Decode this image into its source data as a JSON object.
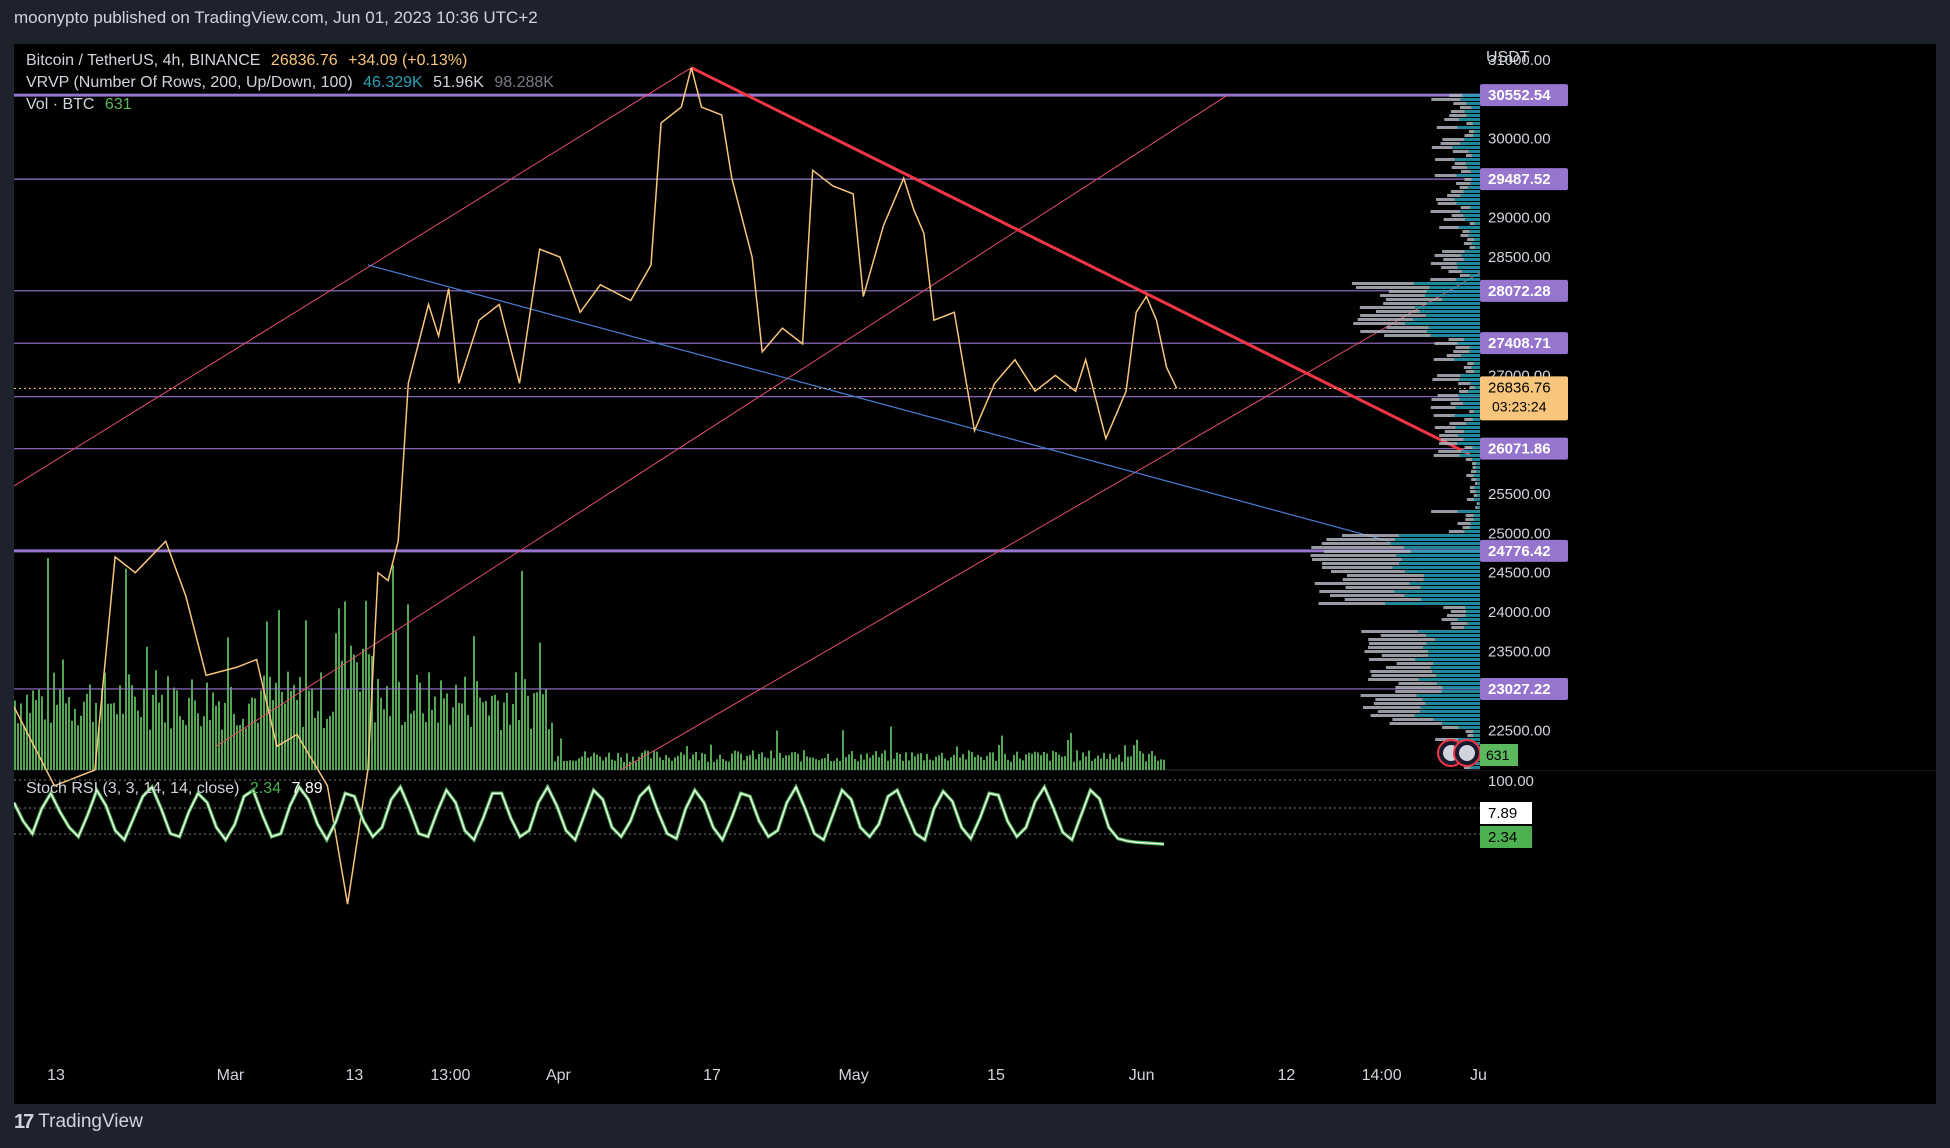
{
  "publisher_line": "moonypto published on TradingView.com, Jun 01, 2023 10:36 UTC+2",
  "footer_brand": "TradingView",
  "legend": {
    "symbol": "Bitcoin / TetherUS, 4h, BINANCE",
    "price": "26836.76",
    "change": "+34.09 (+0.13%)",
    "vrvp_label": "VRVP (Number Of Rows, 200, Up/Down, 100)",
    "vrvp_up": "46.329K",
    "vrvp_down": "51.96K",
    "vrvp_total": "98.288K",
    "vol_label": "Vol · BTC",
    "vol_value": "631",
    "stoch_label": "Stoch RSI (3, 3, 14, 14, close)",
    "stoch_k": "2.34",
    "stoch_d": "7.89"
  },
  "colors": {
    "background": "#000000",
    "price_line": "#f7c57b",
    "volume": "#5cb85c",
    "level_line": "#9575cd",
    "trendline_red": "#f23645",
    "channel_red": "#e04f6a",
    "blue_line": "#4a7fd6",
    "vrvp_up": "#26a0b5",
    "vrvp_down": "#b2b5be",
    "stoch_k": "#ffffff",
    "stoch_d": "#4caf50",
    "current_price_tag": "#f7c57b"
  },
  "chart_data": {
    "type": "line",
    "title": "Bitcoin / TetherUS, 4h, BINANCE",
    "currency": "USDT",
    "ylim": [
      22000,
      31200
    ],
    "price_axis_ticks": [
      "31000.00",
      "30000.00",
      "29000.00",
      "28500.00",
      "27000.00",
      "25500.00",
      "25000.00",
      "24500.00",
      "24000.00",
      "23500.00",
      "22500.00"
    ],
    "time_axis_ticks": [
      "13",
      "Mar",
      "13",
      "13:00",
      "Apr",
      "17",
      "May",
      "15",
      "Jun",
      "12",
      "14:00",
      "Ju"
    ],
    "x_range": [
      "2023-02-06",
      "2023-07-01"
    ],
    "price_series": {
      "name": "BTCUSDT",
      "points": [
        [
          "2023-02-06",
          22800
        ],
        [
          "2023-02-10",
          21800
        ],
        [
          "2023-02-14",
          22000
        ],
        [
          "2023-02-16",
          24700
        ],
        [
          "2023-02-18",
          24500
        ],
        [
          "2023-02-21",
          24900
        ],
        [
          "2023-02-23",
          24200
        ],
        [
          "2023-02-25",
          23200
        ],
        [
          "2023-02-28",
          23300
        ],
        [
          "2023-03-02",
          23400
        ],
        [
          "2023-03-04",
          22300
        ],
        [
          "2023-03-06",
          22450
        ],
        [
          "2023-03-09",
          21800
        ],
        [
          "2023-03-11",
          20300
        ],
        [
          "2023-03-13",
          22000
        ],
        [
          "2023-03-14",
          24500
        ],
        [
          "2023-03-15",
          24400
        ],
        [
          "2023-03-16",
          24900
        ],
        [
          "2023-03-17",
          26900
        ],
        [
          "2023-03-19",
          27900
        ],
        [
          "2023-03-20",
          27500
        ],
        [
          "2023-03-21",
          28100
        ],
        [
          "2023-03-22",
          26900
        ],
        [
          "2023-03-24",
          27700
        ],
        [
          "2023-03-26",
          27900
        ],
        [
          "2023-03-28",
          26900
        ],
        [
          "2023-03-30",
          28600
        ],
        [
          "2023-04-01",
          28500
        ],
        [
          "2023-04-03",
          27800
        ],
        [
          "2023-04-05",
          28150
        ],
        [
          "2023-04-08",
          27950
        ],
        [
          "2023-04-10",
          28400
        ],
        [
          "2023-04-11",
          30200
        ],
        [
          "2023-04-13",
          30400
        ],
        [
          "2023-04-14",
          30900
        ],
        [
          "2023-04-15",
          30400
        ],
        [
          "2023-04-17",
          30300
        ],
        [
          "2023-04-18",
          29500
        ],
        [
          "2023-04-20",
          28500
        ],
        [
          "2023-04-21",
          27300
        ],
        [
          "2023-04-23",
          27600
        ],
        [
          "2023-04-25",
          27400
        ],
        [
          "2023-04-26",
          29600
        ],
        [
          "2023-04-28",
          29400
        ],
        [
          "2023-04-30",
          29300
        ],
        [
          "2023-05-01",
          28000
        ],
        [
          "2023-05-03",
          28900
        ],
        [
          "2023-05-05",
          29500
        ],
        [
          "2023-05-06",
          29100
        ],
        [
          "2023-05-07",
          28800
        ],
        [
          "2023-05-08",
          27700
        ],
        [
          "2023-05-10",
          27800
        ],
        [
          "2023-05-12",
          26300
        ],
        [
          "2023-05-14",
          26900
        ],
        [
          "2023-05-16",
          27200
        ],
        [
          "2023-05-18",
          26800
        ],
        [
          "2023-05-20",
          27000
        ],
        [
          "2023-05-22",
          26800
        ],
        [
          "2023-05-23",
          27200
        ],
        [
          "2023-05-25",
          26200
        ],
        [
          "2023-05-27",
          26800
        ],
        [
          "2023-05-28",
          27800
        ],
        [
          "2023-05-29",
          28000
        ],
        [
          "2023-05-30",
          27700
        ],
        [
          "2023-05-31",
          27100
        ],
        [
          "2023-06-01",
          26837
        ]
      ]
    },
    "horizontal_levels": [
      30552.54,
      29487.52,
      28072.28,
      27408.71,
      26730.71,
      26071.86,
      24776.42,
      23027.22
    ],
    "price_tags": [
      "30552.54",
      "29487.52",
      "28072.28",
      "27408.71",
      "26730.71",
      "26071.86",
      "24776.42",
      "23027.22"
    ],
    "current_price": {
      "value": 26836.76,
      "label": "26836.76",
      "countdown": "03:23:24"
    },
    "volume_last_label": "631",
    "stoch_axis": {
      "top_label": "100.00",
      "k_label": "7.89",
      "d_label": "2.34"
    },
    "stoch_k_values": [
      70,
      40,
      20,
      60,
      85,
      55,
      30,
      15,
      50,
      90,
      65,
      25,
      10,
      45,
      80,
      95,
      60,
      20,
      15,
      55,
      85,
      70,
      30,
      10,
      35,
      80,
      90,
      50,
      15,
      20,
      65,
      95,
      75,
      35,
      10,
      40,
      85,
      80,
      40,
      15,
      30,
      75,
      95,
      60,
      20,
      15,
      55,
      90,
      70,
      25,
      10,
      45,
      85,
      85,
      45,
      15,
      25,
      70,
      95,
      65,
      25,
      10,
      50,
      90,
      75,
      30,
      15,
      40,
      80,
      95,
      55,
      20,
      12,
      60,
      90,
      70,
      30,
      10,
      45,
      85,
      80,
      40,
      15,
      25,
      70,
      95,
      60,
      20,
      10,
      50,
      90,
      75,
      30,
      15,
      35,
      80,
      90,
      55,
      20,
      10,
      60,
      88,
      72,
      30,
      12,
      45,
      85,
      82,
      40,
      15,
      30,
      72,
      95,
      60,
      22,
      10,
      50,
      90,
      76,
      30,
      12,
      8,
      6,
      5,
      4,
      3
    ]
  }
}
